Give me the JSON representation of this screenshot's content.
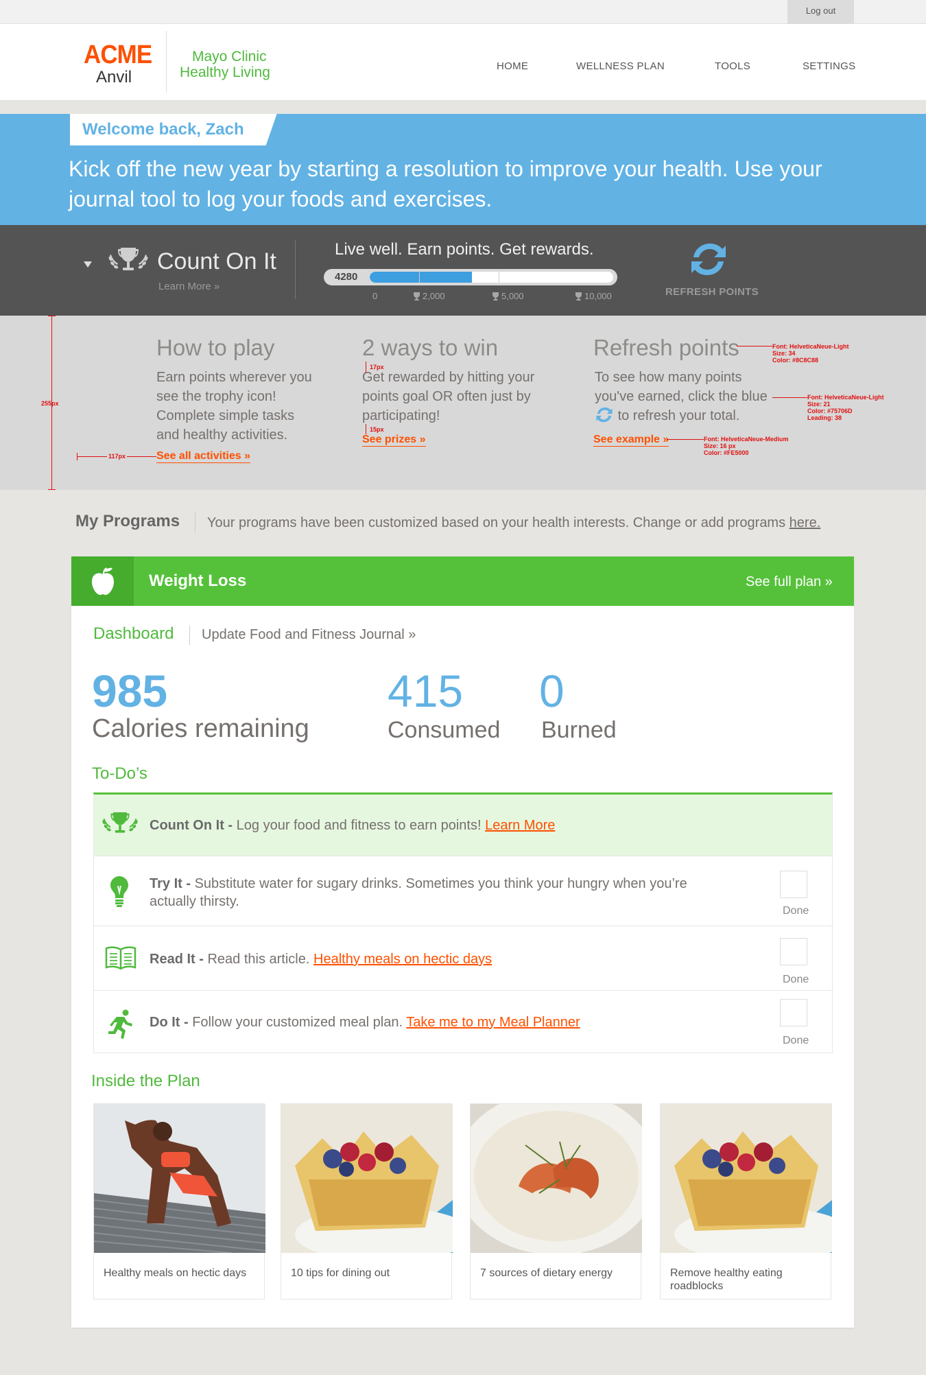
{
  "topbar": {
    "logout": "Log out"
  },
  "brand": {
    "acme": "ACME",
    "anvil": "Anvil",
    "mayo_line1": "Mayo Clinic",
    "mayo_line2": "Healthy Living"
  },
  "nav": {
    "home": "HOME",
    "wellness": "WELLNESS PLAN",
    "tools": "TOOLS",
    "settings": "SETTINGS"
  },
  "welcome": {
    "greeting": "Welcome back, Zach",
    "message": "Kick off the new year by starting a resolution to improve your health. Use your journal tool to log your foods and exercises."
  },
  "points": {
    "title": "Count On It",
    "learn_more": "Learn More »",
    "tagline": "Live well. Earn points. Get rewards.",
    "current": "4280",
    "progress_fraction": 0.42,
    "milestones": [
      "0",
      "2,000",
      "5,000",
      "10,000"
    ],
    "refresh_label": "REFRESH POINTS"
  },
  "info": {
    "how": {
      "title": "How to play",
      "text": "Earn points wherever you see the trophy icon! Complete simple tasks and healthy activities.",
      "link": "See all activities »"
    },
    "ways": {
      "title": "2 ways to win",
      "text": "Get rewarded by hitting your points goal OR often just by participating!",
      "link": "See prizes »"
    },
    "refresh": {
      "title": "Refresh points",
      "text_a": "To see how many points you've earned, click the blue",
      "text_b": "to refresh your total.",
      "link": "See example »"
    }
  },
  "redlines": {
    "h255": "255px",
    "w117": "117px",
    "p17": "17px",
    "p15": "15px",
    "spec_title": [
      "Font: HelveticaNeue-Light",
      "Size: 34",
      "Color: #8C8C88"
    ],
    "spec_body": [
      "Font: HelveticaNeue-Light",
      "Size: 21",
      "Color: #75706D",
      "Leading: 38"
    ],
    "spec_link": [
      "Font: HelveticaNeue-Medium",
      "Size: 16 px",
      "Color: #FE5000"
    ]
  },
  "programs": {
    "title": "My Programs",
    "subtitle": "Your programs have been customized based on your health interests. Change or add programs",
    "here": "here."
  },
  "plan": {
    "name": "Weight Loss",
    "see_full": "See full plan »",
    "tab_dashboard": "Dashboard",
    "tab_journal": "Update Food and Fitness Journal »",
    "calories_remaining": "985",
    "calories_remaining_label": "Calories remaining",
    "consumed": "415",
    "consumed_label": "Consumed",
    "burned": "0",
    "burned_label": "Burned"
  },
  "todos": {
    "heading": "To-Do’s",
    "items": [
      {
        "lead": "Count On It -",
        "text": "Log your food and fitness to earn points!",
        "link": "Learn More"
      },
      {
        "lead": "Try It -",
        "text": "Substitute water for sugary drinks. Sometimes you think your hungry when you’re actually thirsty.",
        "done": "Done"
      },
      {
        "lead": "Read It -",
        "text": "Read this article.",
        "link": "Healthy meals on hectic days",
        "done": "Done"
      },
      {
        "lead": "Do It -",
        "text": "Follow your customized meal plan.",
        "link": "Take me to my Meal Planner",
        "done": "Done"
      }
    ]
  },
  "inside": {
    "heading": "Inside the Plan",
    "tiles": [
      {
        "caption": "Healthy meals on hectic days"
      },
      {
        "caption": "10 tips for dining out"
      },
      {
        "caption": "7 sources of dietary energy"
      },
      {
        "caption": "Remove healthy eating roadblocks"
      }
    ]
  },
  "colors": {
    "orange": "#fe5000",
    "green": "#55c13a",
    "blue": "#62b2e4",
    "dark": "#545454"
  }
}
